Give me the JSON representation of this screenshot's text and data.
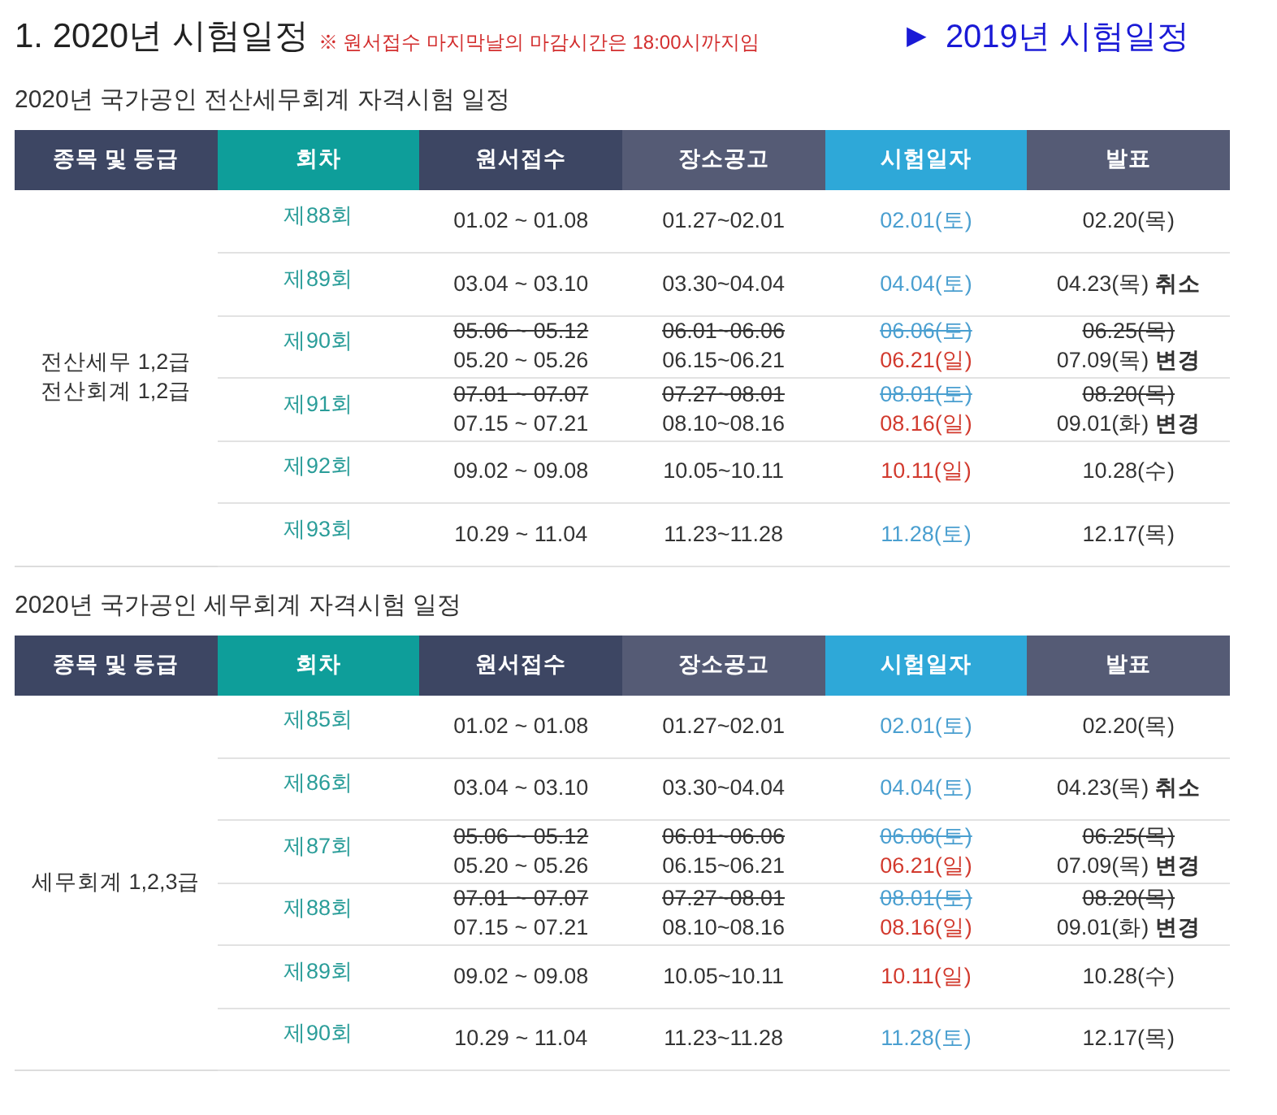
{
  "heading": {
    "title": "1. 2020년 시험일정",
    "notice": "※ 원서접수 마지막날의 마감시간은 18:00시까지임",
    "link": {
      "arrow": "▶",
      "label": "2019년 시험일정"
    }
  },
  "sections": [
    {
      "title": "2020년 국가공인 전산세무회계 자격시험 일정",
      "columns": [
        {
          "label": "종목 및 등급",
          "color": "#3d4663"
        },
        {
          "label": "회차",
          "color": "#0e9e9a"
        },
        {
          "label": "원서접수",
          "color": "#3d4663"
        },
        {
          "label": "장소공고",
          "color": "#555b75"
        },
        {
          "label": "시험일자",
          "color": "#2ea8d8"
        },
        {
          "label": "발표",
          "color": "#555b75"
        }
      ],
      "category": [
        "전산세무 1,2급",
        "전산회계 1,2급"
      ],
      "rows": [
        {
          "round": "제88회",
          "apply": [
            {
              "text": "01.02 ~ 01.08",
              "struck": false
            }
          ],
          "venue": [
            {
              "text": "01.27~02.01",
              "struck": false
            }
          ],
          "exam": [
            {
              "text": "02.01(토)",
              "struck": false,
              "color": "#4a9fd0"
            }
          ],
          "result": [
            {
              "text": "02.20(목)",
              "struck": false
            }
          ]
        },
        {
          "round": "제89회",
          "apply": [
            {
              "text": "03.04 ~ 03.10",
              "struck": false
            }
          ],
          "venue": [
            {
              "text": "03.30~04.04",
              "struck": false
            }
          ],
          "exam": [
            {
              "text": "04.04(토)",
              "struck": false,
              "color": "#4a9fd0"
            }
          ],
          "result": [
            {
              "text": "04.23(목) **취소**",
              "struck": false
            }
          ]
        },
        {
          "round": "제90회",
          "apply": [
            {
              "text": "05.06 ~ 05.12",
              "struck": true
            },
            {
              "text": "05.20 ~ 05.26",
              "struck": false
            }
          ],
          "venue": [
            {
              "text": "06.01~06.06",
              "struck": true
            },
            {
              "text": "06.15~06.21",
              "struck": false
            }
          ],
          "exam": [
            {
              "text": "06.06(토)",
              "struck": true,
              "color": "#4a9fd0"
            },
            {
              "text": "06.21(일)",
              "struck": false,
              "color": "#d23a2e"
            }
          ],
          "result": [
            {
              "text": "06.25(목)",
              "struck": true
            },
            {
              "text": "07.09(목) **변경**",
              "struck": false
            }
          ]
        },
        {
          "round": "제91회",
          "apply": [
            {
              "text": "07.01 ~ 07.07",
              "struck": true
            },
            {
              "text": "07.15 ~ 07.21",
              "struck": false
            }
          ],
          "venue": [
            {
              "text": "07.27~08.01",
              "struck": true
            },
            {
              "text": "08.10~08.16",
              "struck": false
            }
          ],
          "exam": [
            {
              "text": "08.01(토)",
              "struck": true,
              "color": "#4a9fd0"
            },
            {
              "text": "08.16(일)",
              "struck": false,
              "color": "#d23a2e"
            }
          ],
          "result": [
            {
              "text": "08.20(목)",
              "struck": true
            },
            {
              "text": "09.01(화) **변경**",
              "struck": false
            }
          ]
        },
        {
          "round": "제92회",
          "apply": [
            {
              "text": "09.02 ~ 09.08",
              "struck": false
            }
          ],
          "venue": [
            {
              "text": "10.05~10.11",
              "struck": false
            }
          ],
          "exam": [
            {
              "text": "10.11(일)",
              "struck": false,
              "color": "#d23a2e"
            }
          ],
          "result": [
            {
              "text": "10.28(수)",
              "struck": false
            }
          ]
        },
        {
          "round": "제93회",
          "apply": [
            {
              "text": "10.29 ~ 11.04",
              "struck": false
            }
          ],
          "venue": [
            {
              "text": "11.23~11.28",
              "struck": false
            }
          ],
          "exam": [
            {
              "text": "11.28(토)",
              "struck": false,
              "color": "#4a9fd0"
            }
          ],
          "result": [
            {
              "text": "12.17(목)",
              "struck": false
            }
          ]
        }
      ]
    },
    {
      "title": "2020년 국가공인 세무회계 자격시험 일정",
      "columns": [
        {
          "label": "종목 및 등급",
          "color": "#3d4663"
        },
        {
          "label": "회차",
          "color": "#0e9e9a"
        },
        {
          "label": "원서접수",
          "color": "#3d4663"
        },
        {
          "label": "장소공고",
          "color": "#555b75"
        },
        {
          "label": "시험일자",
          "color": "#2ea8d8"
        },
        {
          "label": "발표",
          "color": "#555b75"
        }
      ],
      "category": [
        "세무회계 1,2,3급"
      ],
      "rows": [
        {
          "round": "제85회",
          "apply": [
            {
              "text": "01.02 ~ 01.08",
              "struck": false
            }
          ],
          "venue": [
            {
              "text": "01.27~02.01",
              "struck": false
            }
          ],
          "exam": [
            {
              "text": "02.01(토)",
              "struck": false,
              "color": "#4a9fd0"
            }
          ],
          "result": [
            {
              "text": "02.20(목)",
              "struck": false
            }
          ]
        },
        {
          "round": "제86회",
          "apply": [
            {
              "text": "03.04 ~ 03.10",
              "struck": false
            }
          ],
          "venue": [
            {
              "text": "03.30~04.04",
              "struck": false
            }
          ],
          "exam": [
            {
              "text": "04.04(토)",
              "struck": false,
              "color": "#4a9fd0"
            }
          ],
          "result": [
            {
              "text": "04.23(목) **취소**",
              "struck": false
            }
          ]
        },
        {
          "round": "제87회",
          "apply": [
            {
              "text": "05.06 ~ 05.12",
              "struck": true
            },
            {
              "text": "05.20 ~ 05.26",
              "struck": false
            }
          ],
          "venue": [
            {
              "text": "06.01~06.06",
              "struck": true
            },
            {
              "text": "06.15~06.21",
              "struck": false
            }
          ],
          "exam": [
            {
              "text": "06.06(토)",
              "struck": true,
              "color": "#4a9fd0"
            },
            {
              "text": "06.21(일)",
              "struck": false,
              "color": "#d23a2e"
            }
          ],
          "result": [
            {
              "text": "06.25(목)",
              "struck": true
            },
            {
              "text": "07.09(목) **변경**",
              "struck": false
            }
          ]
        },
        {
          "round": "제88회",
          "apply": [
            {
              "text": "07.01 ~ 07.07",
              "struck": true
            },
            {
              "text": "07.15 ~ 07.21",
              "struck": false
            }
          ],
          "venue": [
            {
              "text": "07.27~08.01",
              "struck": true
            },
            {
              "text": "08.10~08.16",
              "struck": false
            }
          ],
          "exam": [
            {
              "text": "08.01(토)",
              "struck": true,
              "color": "#4a9fd0"
            },
            {
              "text": "08.16(일)",
              "struck": false,
              "color": "#d23a2e"
            }
          ],
          "result": [
            {
              "text": "08.20(목)",
              "struck": true
            },
            {
              "text": "09.01(화) **변경**",
              "struck": false
            }
          ]
        },
        {
          "round": "제89회",
          "apply": [
            {
              "text": "09.02 ~ 09.08",
              "struck": false
            }
          ],
          "venue": [
            {
              "text": "10.05~10.11",
              "struck": false
            }
          ],
          "exam": [
            {
              "text": "10.11(일)",
              "struck": false,
              "color": "#d23a2e"
            }
          ],
          "result": [
            {
              "text": "10.28(수)",
              "struck": false
            }
          ]
        },
        {
          "round": "제90회",
          "apply": [
            {
              "text": "10.29 ~ 11.04",
              "struck": false
            }
          ],
          "venue": [
            {
              "text": "11.23~11.28",
              "struck": false
            }
          ],
          "exam": [
            {
              "text": "11.28(토)",
              "struck": false,
              "color": "#4a9fd0"
            }
          ],
          "result": [
            {
              "text": "12.17(목)",
              "struck": false
            }
          ]
        }
      ]
    }
  ]
}
